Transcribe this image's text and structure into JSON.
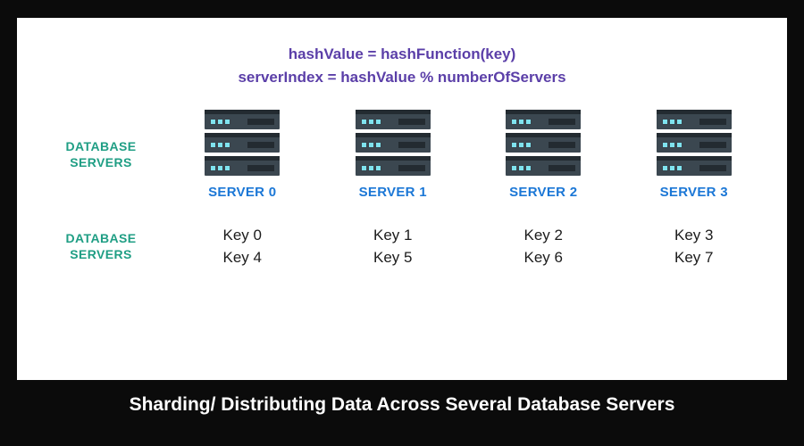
{
  "formula": {
    "line1": "hashValue = hashFunction(key)",
    "line2": "serverIndex = hashValue % numberOfServers"
  },
  "sideLabels": {
    "servers": "DATABASE SERVERS",
    "keys": "DATABASE SERVERS"
  },
  "servers": [
    {
      "name": "SERVER 0",
      "keys": [
        "Key 0",
        "Key 4"
      ]
    },
    {
      "name": "SERVER 1",
      "keys": [
        "Key 1",
        "Key 5"
      ]
    },
    {
      "name": "SERVER 2",
      "keys": [
        "Key 2",
        "Key 6"
      ]
    },
    {
      "name": "SERVER 3",
      "keys": [
        "Key 3",
        "Key 7"
      ]
    }
  ],
  "footer": "Sharding/ Distributing Data Across Several Database Servers"
}
